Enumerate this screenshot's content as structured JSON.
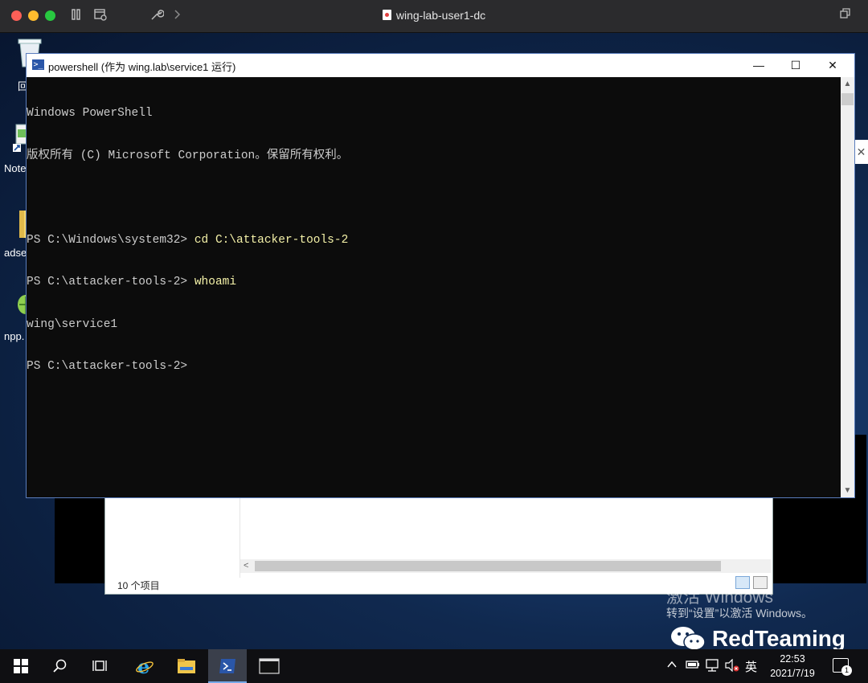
{
  "host": {
    "title": "wing-lab-user1-dc",
    "colors": {
      "close": "#fe5f57",
      "minimize": "#febc2e",
      "zoom": "#28c840"
    },
    "icons": [
      "pause-icon",
      "snapshot-icon",
      "wrench-icon",
      "chevron-right-icon",
      "restore-window-icon"
    ]
  },
  "desktop": {
    "icons": [
      {
        "label": "回",
        "icon": "recycle-bin-icon"
      },
      {
        "label": "Note",
        "icon": "notepad-shortcut-icon"
      },
      {
        "label": "adse",
        "icon": "folder-icon"
      },
      {
        "label": "npp.",
        "icon": "notepad-plus-plus-icon"
      }
    ]
  },
  "powershell": {
    "title": "powershell (作为 wing.lab\\service1 运行)",
    "buttons": {
      "minimize": "—",
      "maximize": "☐",
      "close": "✕"
    },
    "lines": [
      {
        "text": "Windows PowerShell"
      },
      {
        "text": "版权所有 (C) Microsoft Corporation。保留所有权利。"
      },
      {
        "text": ""
      },
      {
        "prompt": "PS C:\\Windows\\system32> ",
        "cmd": "cd C:\\attacker-tools-2"
      },
      {
        "prompt": "PS C:\\attacker-tools-2> ",
        "cmd": "whoami"
      },
      {
        "text": "wing\\service1"
      },
      {
        "prompt": "PS C:\\attacker-tools-2>",
        "cmd": ""
      }
    ],
    "colors": {
      "background": "#0c0c0c",
      "text": "#cccccc",
      "command": "#f4f1a8"
    }
  },
  "explorer": {
    "status_count": "10 个项目"
  },
  "watermark": {
    "line1": "激活 Windows",
    "line2": "转到“设置”以激活 Windows。",
    "brand": "RedTeaming"
  },
  "taskbar": {
    "items": [
      "start-icon",
      "search-icon",
      "task-view-icon",
      "internet-explorer-icon",
      "file-explorer-icon",
      "powershell-icon",
      "cmd-icon"
    ],
    "tray": {
      "ime": "英"
    },
    "clock": {
      "time": "22:53",
      "date": "2021/7/19"
    },
    "notifications": "1",
    "accent": "#76a9e8"
  }
}
